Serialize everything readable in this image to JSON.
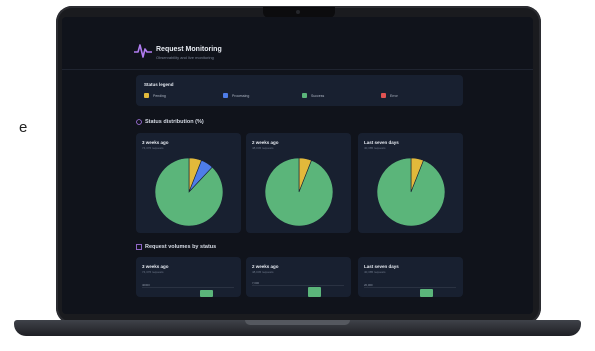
{
  "app": {
    "title": "Request Monitoring",
    "subtitle": "Observability and live monitoring"
  },
  "colors": {
    "pending": "#e2b93b",
    "processing": "#4e7de8",
    "success": "#5bb57a",
    "error": "#e05252"
  },
  "legend": {
    "title": "Status legend",
    "items": [
      {
        "label": "Pending",
        "color": "#e2b93b"
      },
      {
        "label": "Processing",
        "color": "#4e7de8"
      },
      {
        "label": "Success",
        "color": "#5bb57a"
      },
      {
        "label": "Error",
        "color": "#e05252"
      }
    ]
  },
  "distribution": {
    "title": "Status distribution (%)",
    "panels": [
      {
        "title": "3 weeks ago",
        "subtitle": "74,376 requests"
      },
      {
        "title": "2 weeks ago",
        "subtitle": "48,045 requests"
      },
      {
        "title": "Last seven days",
        "subtitle": "40,385 requests"
      }
    ]
  },
  "volumes": {
    "title": "Request volumes by status",
    "panels": [
      {
        "title": "3 weeks ago",
        "subtitle": "74,376 requests",
        "tick": "40000"
      },
      {
        "title": "2 weeks ago",
        "subtitle": "48,045 requests",
        "tick": "7,000"
      },
      {
        "title": "Last seven days",
        "subtitle": "40,385 requests",
        "tick": "20,000"
      }
    ]
  },
  "chart_data": [
    {
      "type": "pie",
      "title": "3 weeks ago",
      "categories": [
        "Pending",
        "Processing",
        "Success",
        "Error"
      ],
      "values": [
        6,
        6,
        88,
        0
      ]
    },
    {
      "type": "pie",
      "title": "2 weeks ago",
      "categories": [
        "Pending",
        "Processing",
        "Success",
        "Error"
      ],
      "values": [
        6,
        0,
        94,
        0
      ]
    },
    {
      "type": "pie",
      "title": "Last seven days",
      "categories": [
        "Pending",
        "Processing",
        "Success",
        "Error"
      ],
      "values": [
        6,
        0,
        94,
        0
      ]
    }
  ]
}
